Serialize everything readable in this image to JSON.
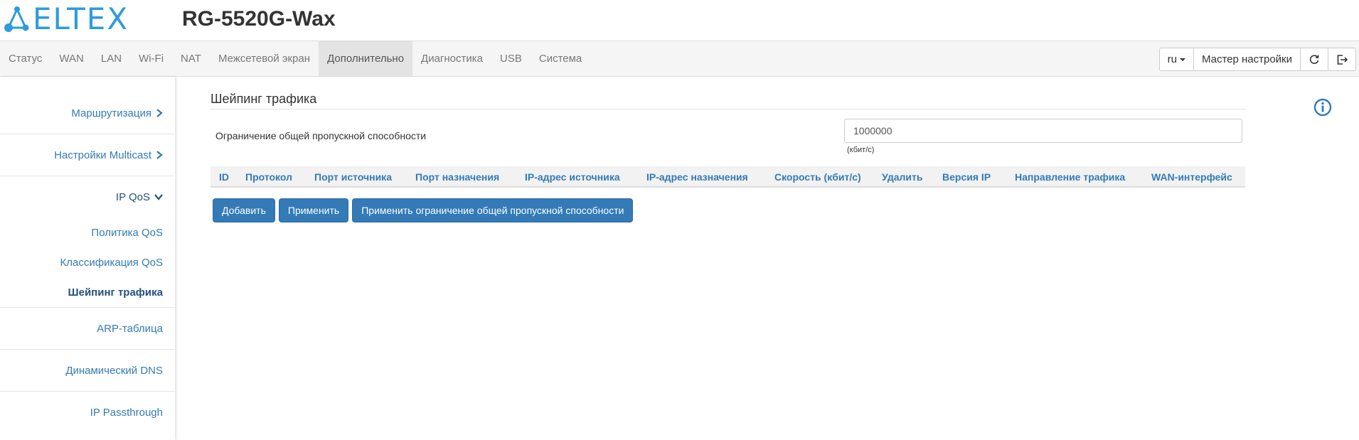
{
  "header": {
    "logo_text": "ELTEX",
    "device_model": "RG-5520G-Wax"
  },
  "nav": {
    "items": [
      {
        "label": "Статус"
      },
      {
        "label": "WAN"
      },
      {
        "label": "LAN"
      },
      {
        "label": "Wi-Fi"
      },
      {
        "label": "NAT"
      },
      {
        "label": "Межсетевой экран"
      },
      {
        "label": "Дополнительно",
        "active": true
      },
      {
        "label": "Диагностика"
      },
      {
        "label": "USB"
      },
      {
        "label": "Система"
      }
    ],
    "language": "ru",
    "wizard_label": "Мастер настройки",
    "refresh_icon": "refresh-icon",
    "logout_icon": "logout-icon"
  },
  "sidebar": {
    "routing": "Маршрутизация",
    "multicast": "Настройки Multicast",
    "ipqos": "IP QoS",
    "qos_policy": "Политика QoS",
    "qos_classification": "Классификация QoS",
    "traffic_shaping": "Шейпинг трафика",
    "arp_table": "ARP-таблица",
    "dynamic_dns": "Динамический DNS",
    "ip_passthrough": "IP Passthrough"
  },
  "main": {
    "title": "Шейпинг трафика",
    "bandwidth_label": "Ограничение общей пропускной способности",
    "bandwidth_value": "1000000",
    "bandwidth_unit": "(кбит/с)",
    "columns": [
      "ID",
      "Протокол",
      "Порт источника",
      "Порт назначения",
      "IP-адрес источника",
      "IP-адрес назначения",
      "Скорость (кбит/с)",
      "Удалить",
      "Версия IP",
      "Направление трафика",
      "WAN-интерфейс"
    ],
    "buttons": {
      "add": "Добавить",
      "apply": "Применить",
      "apply_limit": "Применить ограничение общей пропускной способности"
    }
  },
  "colors": {
    "brand": "#2d9cdb",
    "link": "#337ab7",
    "primary_button": "#337ab7"
  }
}
